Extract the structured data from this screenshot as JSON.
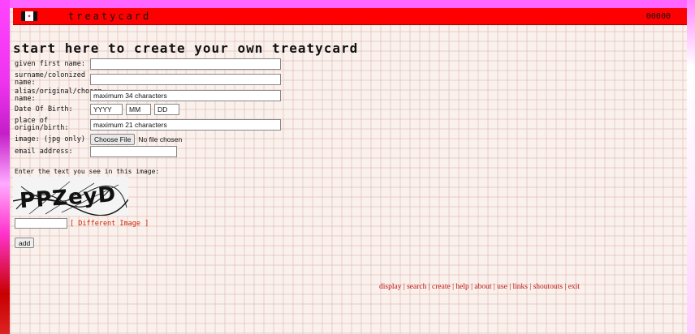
{
  "header": {
    "site_name": "treatycard",
    "counter": "00000",
    "flag_symbol": "✦"
  },
  "page_title": "start here to create your own treatycard",
  "form": {
    "first_name_label": "given first name:",
    "first_name_value": "",
    "surname_label": "surname/colonized name:",
    "surname_value": "",
    "alias_label": "alias/original/chosen name:",
    "alias_value": "maximum 34 characters",
    "dob_label": "Date Of Birth:",
    "dob_year": "YYYY",
    "dob_month": "MM",
    "dob_day": "DD",
    "origin_label": "place of origin/birth:",
    "origin_value": "maximum 21 characters",
    "image_label": "image: (jpg only)",
    "choose_file_label": "Choose File",
    "file_status": "No file chosen",
    "email_label": "email address:",
    "email_value": ""
  },
  "captcha": {
    "prompt": "Enter the text you see in this image:",
    "image_text": "PPZeyD",
    "input_value": "",
    "different_image_label": "[ Different Image ]"
  },
  "add_button_label": "add",
  "footer_nav": [
    "display",
    "search",
    "create",
    "help",
    "about",
    "use",
    "links",
    "shoutouts",
    "exit"
  ],
  "colors": {
    "header_red": "#ff0000",
    "link_red": "#bb1111",
    "background": "#fbf1ec"
  }
}
